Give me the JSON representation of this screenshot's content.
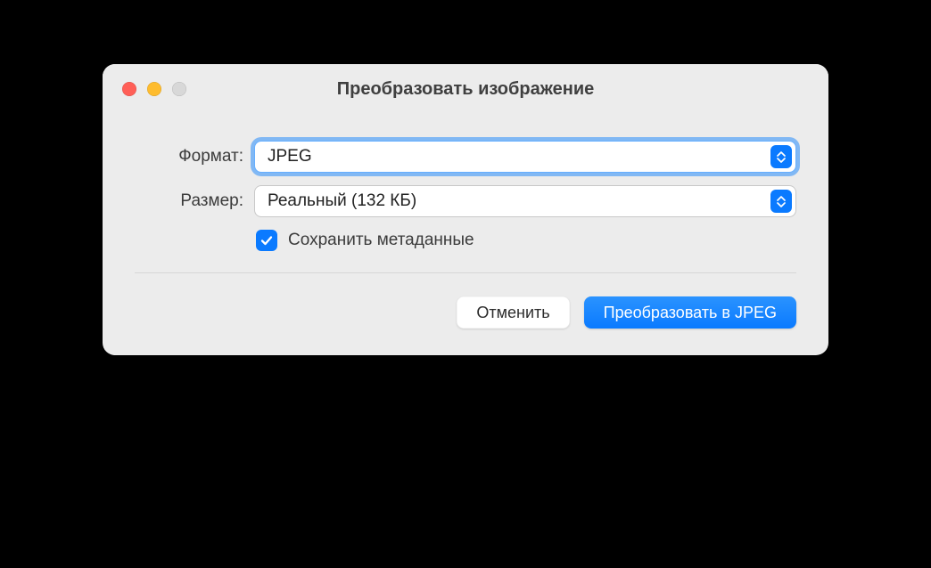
{
  "window": {
    "title": "Преобразовать изображение"
  },
  "form": {
    "format_label": "Формат:",
    "format_value": "JPEG",
    "size_label": "Размер:",
    "size_value": "Реальный (132 КБ)",
    "preserve_metadata_label": "Сохранить метаданные",
    "preserve_metadata_checked": true
  },
  "footer": {
    "cancel_label": "Отменить",
    "convert_label": "Преобразовать в JPEG"
  }
}
